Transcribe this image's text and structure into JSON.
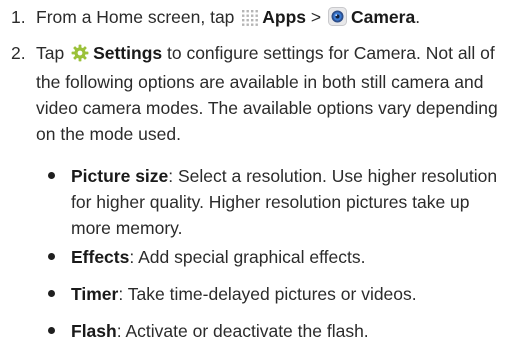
{
  "steps": [
    {
      "number": "1.",
      "pre": "From a Home screen, tap ",
      "apps_label": "Apps",
      "separator": " > ",
      "camera_label": "Camera",
      "end": "."
    },
    {
      "number": "2.",
      "pre": "Tap ",
      "settings_label": "Settings",
      "text": " to configure settings for Camera. Not all of the following options are available in both still camera and video camera modes. The available options vary depending on the mode used."
    }
  ],
  "options": [
    {
      "term": "Picture size",
      "desc": ": Select a resolution. Use higher resolution for higher quality. Higher resolution pictures take up more memory."
    },
    {
      "term": "Effects",
      "desc": ": Add special graphical effects."
    },
    {
      "term": "Timer",
      "desc": ": Take time-delayed pictures or videos."
    },
    {
      "term": "Flash",
      "desc": ": Activate or deactivate the flash."
    }
  ],
  "icons": {
    "apps": "apps-grid-icon",
    "camera": "camera-app-icon",
    "settings": "settings-gear-icon"
  },
  "colors": {
    "text": "#2b2b2b",
    "camera_icon_blue": "#3a7bd5",
    "settings_icon_green": "#9bc13a"
  }
}
